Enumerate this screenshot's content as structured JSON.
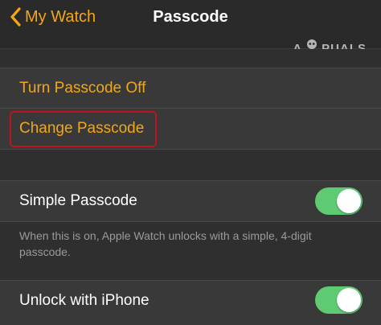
{
  "nav": {
    "back_label": "My Watch",
    "title": "Passcode"
  },
  "watermark": {
    "text_before": "A",
    "text_after": "PUALS"
  },
  "group1": {
    "turn_off_label": "Turn Passcode Off",
    "change_label": "Change Passcode"
  },
  "group2": {
    "simple_label": "Simple Passcode",
    "simple_on": true,
    "simple_footer": "When this is on, Apple Watch unlocks with a simple, 4-digit passcode.",
    "unlock_label": "Unlock with iPhone",
    "unlock_on": true
  },
  "colors": {
    "accent": "#f3a712",
    "toggle_on": "#5ecb73",
    "highlight": "#c1121f",
    "row_bg": "#393939",
    "page_bg": "#2f2f2f"
  },
  "icons": {
    "back": "chevron-left-icon",
    "mascot": "appuals-mascot-icon"
  }
}
